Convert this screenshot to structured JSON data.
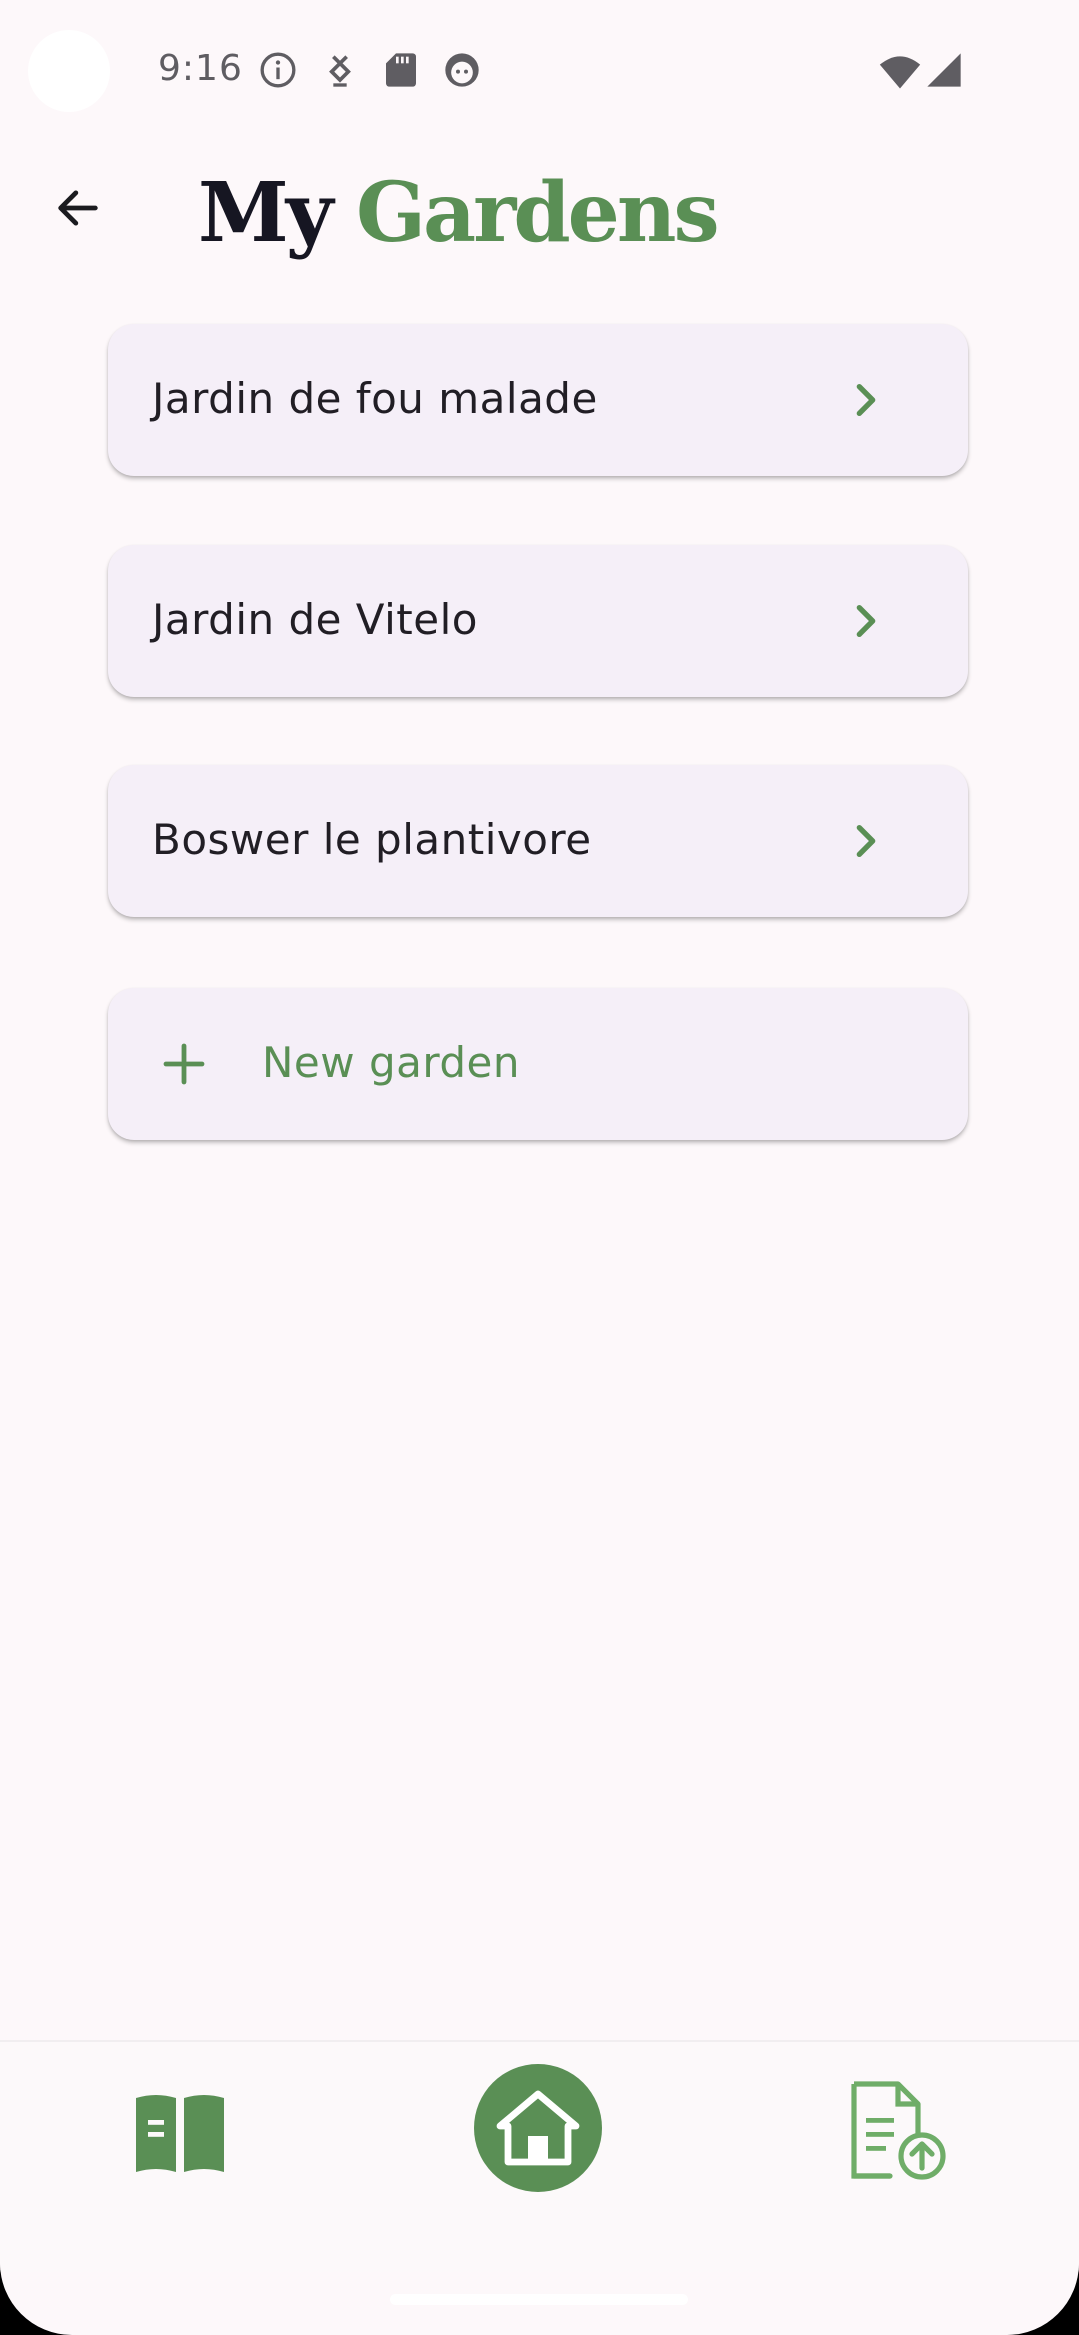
{
  "status_bar": {
    "time": "9:16",
    "left_icons": [
      "info-icon",
      "download-icon",
      "sd-card-icon",
      "face-icon"
    ],
    "right_icons": [
      "wifi-icon",
      "cellular-signal-icon"
    ]
  },
  "header": {
    "title_part1": "My",
    "title_part2": "Gardens",
    "back_icon": "arrow-back-icon"
  },
  "gardens": [
    {
      "name": "Jardin de fou malade"
    },
    {
      "name": "Jardin de Vitelo"
    },
    {
      "name": "Boswer le plantivore"
    }
  ],
  "new_garden": {
    "label": "New garden",
    "icon": "plus-icon"
  },
  "bottom_nav": {
    "items": [
      {
        "icon": "guide-book-icon",
        "active": false
      },
      {
        "icon": "home-icon",
        "active": true
      },
      {
        "icon": "document-upload-icon",
        "active": false
      }
    ]
  },
  "colors": {
    "accent": "#5a8f55",
    "background": "#fdf8fa",
    "card": "#f5eff8",
    "title_dark": "#161622",
    "text": "#211e25"
  }
}
